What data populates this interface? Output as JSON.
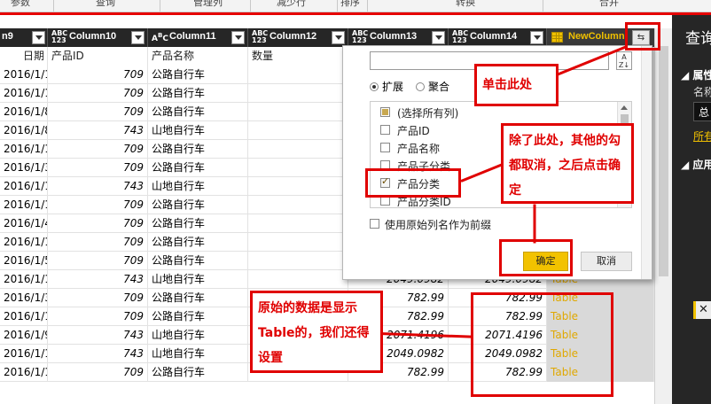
{
  "ribbon": {
    "labels": [
      "参数",
      "查询",
      "管理列",
      "减少行",
      "排序",
      "转换",
      "合并"
    ]
  },
  "columns": {
    "date": {
      "type": "",
      "name": "n9"
    },
    "c10": {
      "type": "ABC\n123",
      "name": "Column10"
    },
    "c11": {
      "type": "A B C",
      "name": "Column11"
    },
    "c12": {
      "type": "ABC\n123",
      "name": "Column12"
    },
    "c13": {
      "type": "ABC\n123",
      "name": "Column13"
    },
    "c14": {
      "type": "ABC\n123",
      "name": "Column14"
    },
    "new": {
      "name": "NewColumn"
    }
  },
  "grid_header": {
    "date": "日期",
    "id": "产品ID",
    "name": "产品名称",
    "qty": "数量"
  },
  "rows": [
    {
      "date": "2016/1/11",
      "id": "709",
      "name": "公路自行车",
      "c13": "",
      "c14": "",
      "new": ""
    },
    {
      "date": "2016/1/15",
      "id": "709",
      "name": "公路自行车",
      "c13": "",
      "c14": "",
      "new": ""
    },
    {
      "date": "2016/1/8",
      "id": "709",
      "name": "公路自行车",
      "c13": "",
      "c14": "",
      "new": ""
    },
    {
      "date": "2016/1/8",
      "id": "743",
      "name": "山地自行车",
      "c13": "",
      "c14": "",
      "new": ""
    },
    {
      "date": "2016/1/11",
      "id": "709",
      "name": "公路自行车",
      "c13": "",
      "c14": "",
      "new": ""
    },
    {
      "date": "2016/1/3",
      "id": "709",
      "name": "公路自行车",
      "c13": "",
      "c14": "",
      "new": ""
    },
    {
      "date": "2016/1/10",
      "id": "743",
      "name": "山地自行车",
      "c13": "",
      "c14": "",
      "new": ""
    },
    {
      "date": "2016/1/16",
      "id": "709",
      "name": "公路自行车",
      "c13": "",
      "c14": "",
      "new": ""
    },
    {
      "date": "2016/1/4",
      "id": "709",
      "name": "公路自行车",
      "c13": "",
      "c14": "",
      "new": ""
    },
    {
      "date": "2016/1/15",
      "id": "709",
      "name": "公路自行车",
      "c13": "",
      "c14": "",
      "new": ""
    },
    {
      "date": "2016/1/5",
      "id": "709",
      "name": "公路自行车",
      "c13": "",
      "c14": "",
      "new": ""
    },
    {
      "date": "2016/1/17",
      "id": "743",
      "name": "山地自行车",
      "c13": "2049.0982",
      "c14": "2049.0982",
      "new": "Table"
    },
    {
      "date": "2016/1/3",
      "id": "709",
      "name": "公路自行车",
      "c13": "782.99",
      "c14": "782.99",
      "new": "Table"
    },
    {
      "date": "2016/1/12",
      "id": "709",
      "name": "公路自行车",
      "c13": "782.99",
      "c14": "782.99",
      "new": "Table"
    },
    {
      "date": "2016/1/9",
      "id": "743",
      "name": "山地自行车",
      "c13": "2071.4196",
      "c14": "2071.4196",
      "new": "Table"
    },
    {
      "date": "2016/1/12",
      "id": "743",
      "name": "山地自行车",
      "c13": "2049.0982",
      "c14": "2049.0982",
      "new": "Table"
    },
    {
      "date": "2016/1/14",
      "id": "709",
      "name": "公路自行车",
      "c13": "782.99",
      "c14": "782.99",
      "new": "Table"
    }
  ],
  "right_panel": {
    "title": "查询",
    "section1": "属性",
    "name_label": "名称",
    "name_value": "总",
    "link": "所有",
    "section2": "应用"
  },
  "popup": {
    "search_value": "",
    "sort_icon": "A Z ↓",
    "radio_expand": "扩展",
    "radio_aggregate": "聚合",
    "items": [
      {
        "label": "(选择所有列)",
        "state": "partial"
      },
      {
        "label": "产品ID",
        "state": "off"
      },
      {
        "label": "产品名称",
        "state": "off"
      },
      {
        "label": "产品子分类",
        "state": "off"
      },
      {
        "label": "产品分类",
        "state": "on"
      },
      {
        "label": "产品分类ID",
        "state": "off"
      }
    ],
    "prefix_label": "使用原始列名作为前缀",
    "ok": "确定",
    "cancel": "取消"
  },
  "annotations": {
    "click_here": "单击此处",
    "uncheck_others": "除了此处，其他的勾都取消，之后点击确定",
    "table_note": "原始的数据是显示Table的，我们还得设置"
  },
  "colors": {
    "annotation_red": "#e00000",
    "accent_yellow": "#f2c200",
    "header_dark": "#262626",
    "table_text": "#e0a800"
  }
}
